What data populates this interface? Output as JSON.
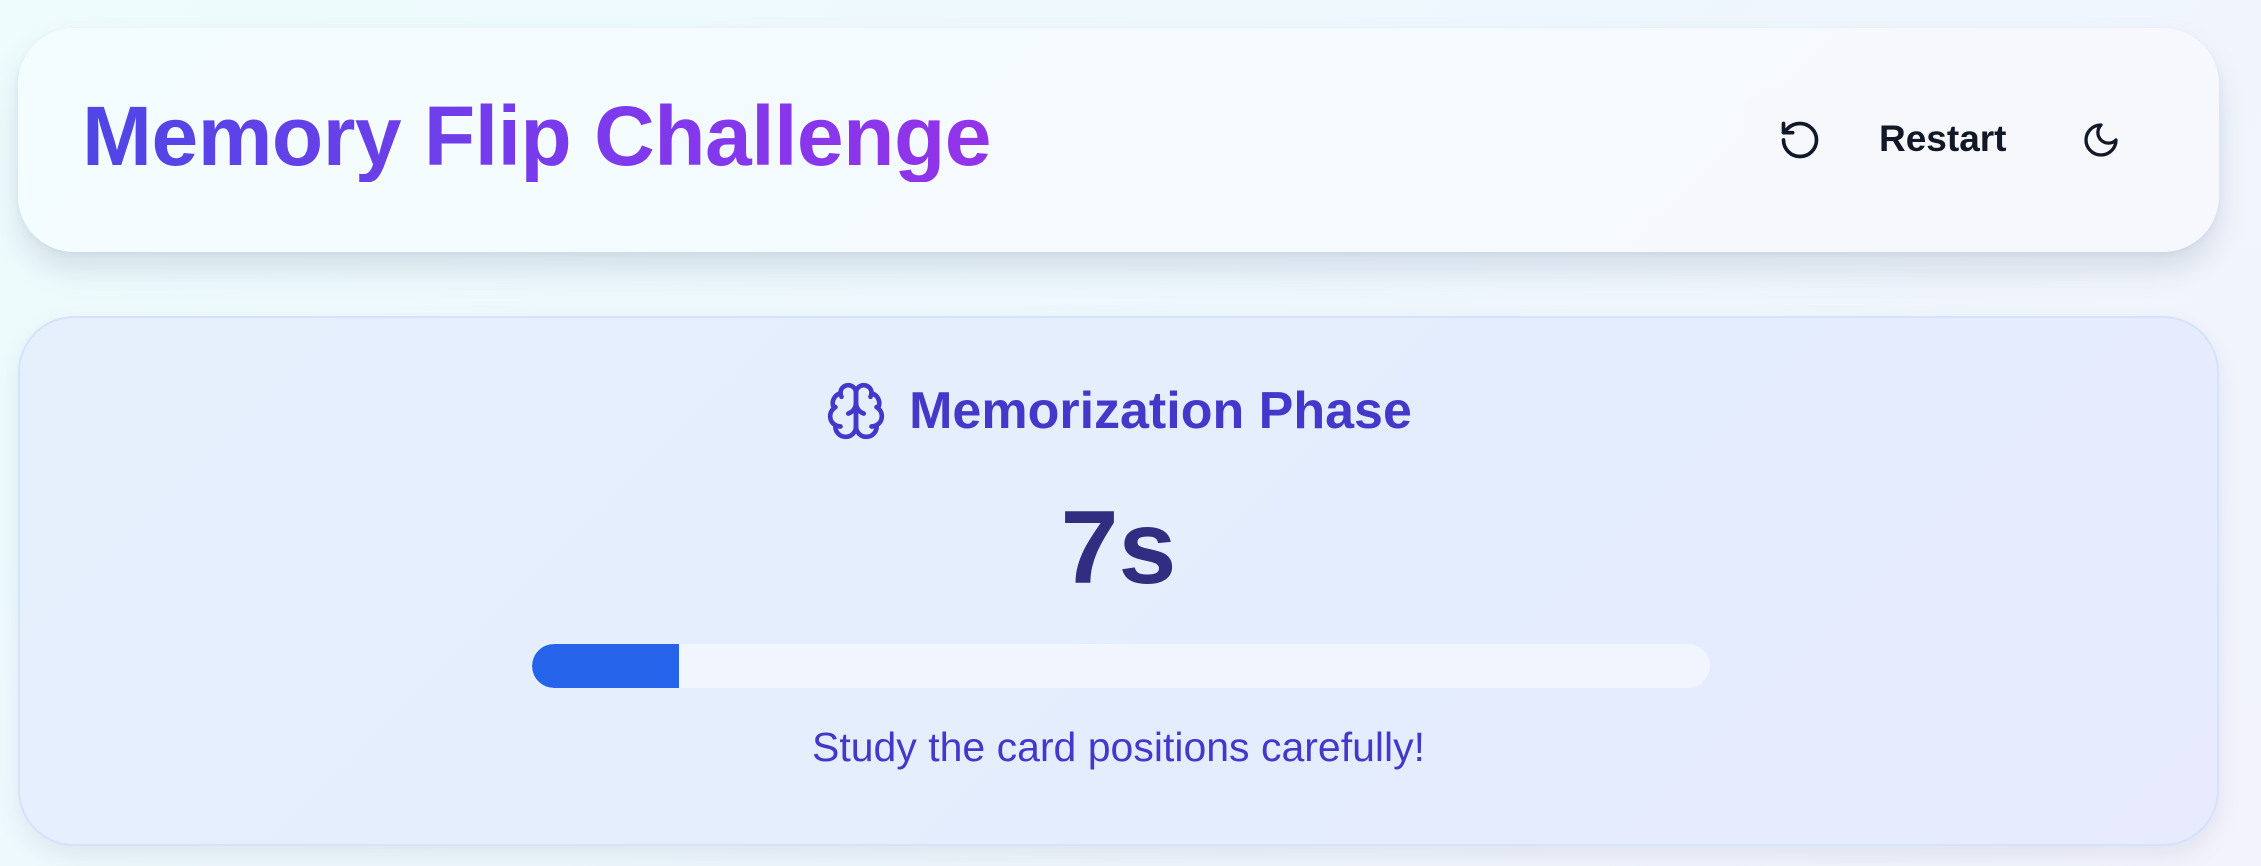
{
  "header": {
    "title": "Memory Flip Challenge",
    "restart_label": "Restart",
    "restart_icon": "rotate-ccw-icon",
    "theme_icon": "moon-icon"
  },
  "phase": {
    "icon": "brain-icon",
    "title": "Memorization Phase",
    "countdown": "7s",
    "progress_fraction": 0.125,
    "hint": "Study the card positions carefully!"
  },
  "colors": {
    "title_gradient_start": "#4f46e5",
    "title_gradient_end": "#9333ea",
    "phase_text": "#4338ca",
    "countdown_text": "#312e81",
    "progress_fill": "#2563eb",
    "progress_track": "#f1f5fd"
  }
}
